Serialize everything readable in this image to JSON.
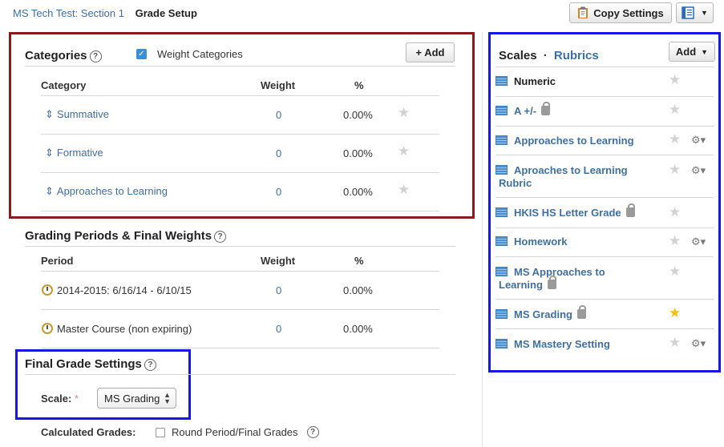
{
  "header": {
    "breadcrumb_course": "MS Tech Test: Section 1",
    "breadcrumb_page": "Grade Setup",
    "copy_settings_label": "Copy Settings",
    "copy_icon": "clipboard-icon",
    "view_icon": "layout-icon"
  },
  "categories": {
    "title": "Categories",
    "weight_label": "Weight Categories",
    "weight_checked": true,
    "add_label": "+ Add",
    "columns": [
      "Category",
      "Weight",
      "%"
    ],
    "rows": [
      {
        "name": "Summative",
        "weight": "0",
        "percent": "0.00%"
      },
      {
        "name": "Formative",
        "weight": "0",
        "percent": "0.00%"
      },
      {
        "name": "Approaches to Learning",
        "weight": "0",
        "percent": "0.00%"
      }
    ]
  },
  "grading_periods": {
    "title": "Grading Periods & Final Weights",
    "columns": [
      "Period",
      "Weight",
      "%"
    ],
    "rows": [
      {
        "name": "2014-2015: 6/16/14 - 6/10/15",
        "weight": "0",
        "percent": "0.00%"
      },
      {
        "name": "Master Course (non expiring)",
        "weight": "0",
        "percent": "0.00%"
      }
    ]
  },
  "final_grade": {
    "title": "Final Grade Settings",
    "scale_label": "Scale:",
    "required_mark": "*",
    "scale_value": "MS Grading",
    "calculated_label": "Calculated Grades:",
    "round_label": "Round Period/Final Grades"
  },
  "scales": {
    "title": "Scales",
    "separator": "·",
    "rubrics_label": "Rubrics",
    "add_label": "Add",
    "items": [
      {
        "line1": "Numeric",
        "line2": "",
        "locked": false,
        "default": false,
        "gear": false
      },
      {
        "line1": "A +/-",
        "line2": "",
        "locked": true,
        "default": false,
        "gear": false
      },
      {
        "line1": "Approaches to Learning",
        "line2": "",
        "locked": false,
        "default": false,
        "gear": true
      },
      {
        "line1": "Aproaches to Learning",
        "line2": "Rubric",
        "locked": false,
        "default": false,
        "gear": true
      },
      {
        "line1": "HKIS HS Letter Grade",
        "line2": "",
        "locked": true,
        "default": false,
        "gear": false
      },
      {
        "line1": "Homework",
        "line2": "",
        "locked": false,
        "default": false,
        "gear": true
      },
      {
        "line1": "MS Approaches to",
        "line2": "Learning",
        "locked": true,
        "default": false,
        "gear": false
      },
      {
        "line1": "MS Grading",
        "line2": "",
        "locked": true,
        "default": true,
        "gear": false
      },
      {
        "line1": "MS Mastery Setting",
        "line2": "",
        "locked": false,
        "default": false,
        "gear": true
      }
    ]
  },
  "colors": {
    "link": "#3f6fa1",
    "highlight_red": "#8b1a1a",
    "highlight_blue": "#1417e6",
    "star_default": "#f2c01f"
  }
}
